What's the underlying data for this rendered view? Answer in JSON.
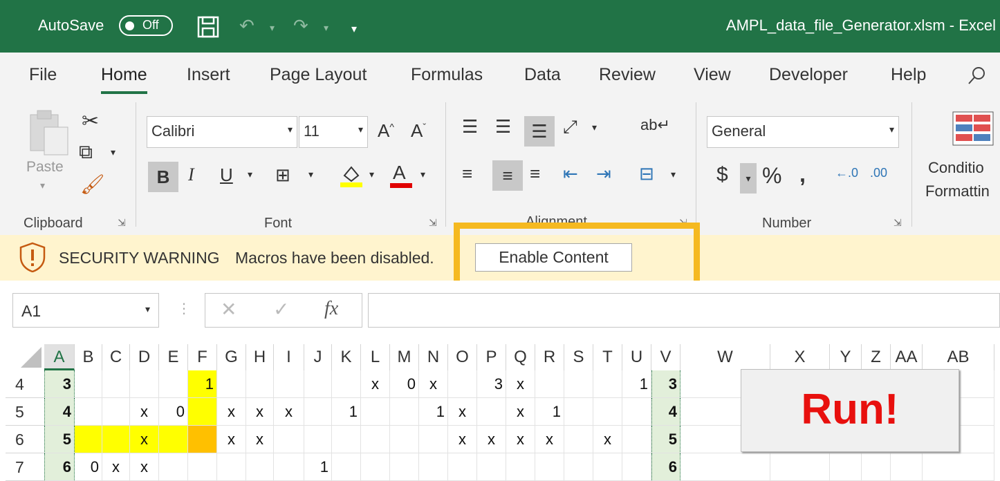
{
  "titlebar": {
    "autosave_label": "AutoSave",
    "autosave_state": "Off",
    "title": "AMPL_data_file_Generator.xlsm  -  Excel"
  },
  "tabs": [
    "File",
    "Home",
    "Insert",
    "Page Layout",
    "Formulas",
    "Data",
    "Review",
    "View",
    "Developer",
    "Help"
  ],
  "ribbon": {
    "clipboard": {
      "paste_label": "Paste",
      "group_label": "Clipboard"
    },
    "font": {
      "font_name": "Calibri",
      "font_size": "11",
      "group_label": "Font"
    },
    "alignment": {
      "group_label": "Alignment"
    },
    "number": {
      "format": "General",
      "group_label": "Number"
    },
    "styles": {
      "conditional_line1": "Conditio",
      "conditional_line2": "Formattin"
    }
  },
  "security_bar": {
    "title": "SECURITY WARNING",
    "message": "Macros have been disabled.",
    "button_label": "Enable Content"
  },
  "formula_bar": {
    "name_box": "A1",
    "fx_label": "fx",
    "formula": ""
  },
  "grid": {
    "columns": [
      "A",
      "B",
      "C",
      "D",
      "E",
      "F",
      "G",
      "H",
      "I",
      "J",
      "K",
      "L",
      "M",
      "N",
      "O",
      "P",
      "Q",
      "R",
      "S",
      "T",
      "U",
      "V",
      "W",
      "X",
      "Y",
      "Z",
      "AA",
      "AB"
    ],
    "rows": [
      {
        "num": "4",
        "cells": {
          "A": "3",
          "F": "1",
          "L": "x",
          "M": "0",
          "N": "x",
          "P": "3",
          "Q": "x",
          "U": "1",
          "V": "3"
        }
      },
      {
        "num": "5",
        "cells": {
          "A": "4",
          "D": "x",
          "E": "0",
          "G": "x",
          "H": "x",
          "I": "x",
          "K": "1",
          "N": "1",
          "O": "x",
          "Q": "x",
          "R": "1",
          "V": "4"
        }
      },
      {
        "num": "6",
        "cells": {
          "A": "5",
          "D": "x",
          "G": "x",
          "H": "x",
          "O": "x",
          "P": "x",
          "Q": "x",
          "R": "x",
          "T": "x",
          "V": "5"
        }
      },
      {
        "num": "7",
        "cells": {
          "A": "6",
          "B": "0",
          "C": "x",
          "D": "x",
          "J": "1",
          "V": "6"
        }
      }
    ]
  },
  "run_button_label": "Run!",
  "colors": {
    "excel_green": "#217346",
    "warning_bg": "#fff4ce",
    "highlight": "#f5b920",
    "cell_yellow": "#ffff00",
    "cell_orange": "#ffc000",
    "run_red": "#e8100e"
  }
}
